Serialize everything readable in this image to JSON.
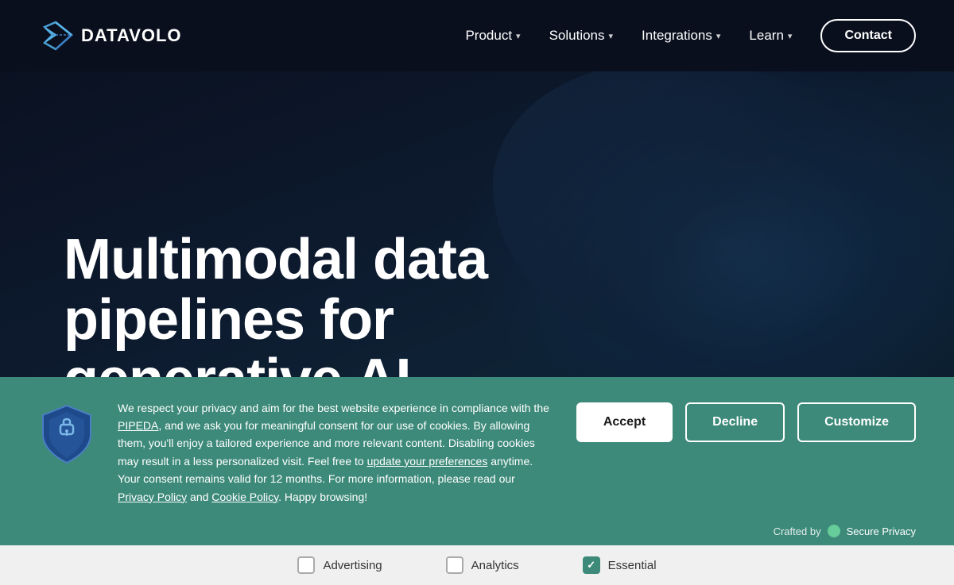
{
  "nav": {
    "logo_text": "DATAVOLO",
    "links": [
      {
        "label": "Product",
        "has_dropdown": true
      },
      {
        "label": "Solutions",
        "has_dropdown": true
      },
      {
        "label": "Integrations",
        "has_dropdown": true
      },
      {
        "label": "Learn",
        "has_dropdown": true
      }
    ],
    "contact_label": "Contact"
  },
  "hero": {
    "title_line1": "Multimodal data",
    "title_line2": "pipelines for",
    "title_line3": "generative AI"
  },
  "cookie": {
    "body_text_1": "We respect your privacy and aim for the best website experience in compliance with the ",
    "pipeda_link": "PIPEDA",
    "body_text_2": ", and we ask you for meaningful consent for our use of cookies. By allowing them, you'll enjoy a tailored experience and more relevant content. Disabling cookies may result in a less personalized visit. Feel free to ",
    "preferences_link": "update your preferences",
    "body_text_3": " anytime. Your consent remains valid for 12 months. For more information, please read our ",
    "privacy_link": "Privacy Policy",
    "body_text_4": " and ",
    "cookie_link": "Cookie Policy",
    "body_text_5": ". Happy browsing!",
    "accept_label": "Accept",
    "decline_label": "Decline",
    "customize_label": "Customize",
    "crafted_label": "Crafted by",
    "secure_privacy_label": "Secure Privacy",
    "checkboxes": [
      {
        "label": "Advertising",
        "checked": false
      },
      {
        "label": "Analytics",
        "checked": false
      },
      {
        "label": "Essential",
        "checked": true
      }
    ]
  },
  "icons": {
    "chevron": "▾"
  }
}
